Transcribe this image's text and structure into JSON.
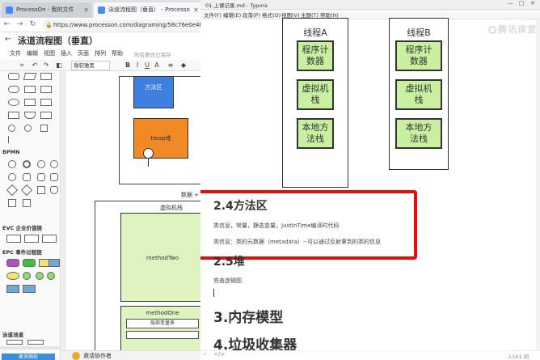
{
  "browser": {
    "tabs": [
      {
        "label": "ProcessOn - 我的文件"
      },
      {
        "label": "泳道流程图（垂直） - Processo"
      }
    ],
    "url": "https://www.processon.com/diagraming/58c76e0e4b",
    "nav": {
      "back": "←",
      "forward": "→",
      "reload": "↻"
    }
  },
  "processon": {
    "back_arrow": "←",
    "title": "泳道流程图（垂直）",
    "menu": [
      "文件",
      "编辑",
      "视图",
      "插入",
      "页面",
      "排列",
      "帮助"
    ],
    "saved_text": "所有更改已保存",
    "toolbar": {
      "undo": "↶",
      "redo": "↷",
      "bold": "B",
      "italic": "I",
      "underline": "U",
      "font_color": "A",
      "align": "≡"
    },
    "font_value": "微软雅黑",
    "categories": [
      "BPMN",
      "EVC 企业价值链",
      "EPC 事件过程链",
      "泳道池道"
    ],
    "more_shapes": "更多图形",
    "canvas": {
      "method_area": "方法区",
      "heap": "Heap堆",
      "mid_label": "数据 + 指令",
      "jvm_stack": "虚拟机栈",
      "method_two": "methodTwo",
      "method_one": "methodOne",
      "local_vars": "局部变量表"
    },
    "status": {
      "invite": "邀请协作者"
    }
  },
  "typora": {
    "window_title": "01.上课记录.md - Typora",
    "window_controls": {
      "minimize": "—",
      "maximize": "□",
      "close": "✕"
    },
    "menu": [
      "文件(F)",
      "编辑(E)",
      "段落(P)",
      "格式(O)",
      "视图(V)",
      "主题(T)",
      "帮助(H)"
    ],
    "watermark": "腾讯课堂",
    "thread_a": {
      "label": "线程A",
      "boxes": [
        "程序计\n数器",
        "虚拟机\n栈",
        "本地方\n法栈"
      ]
    },
    "thread_b": {
      "label": "线程B",
      "boxes": [
        "程序计\n数器",
        "虚拟机\n栈",
        "本地方\n法栈"
      ]
    },
    "section_24": {
      "heading": "2.4方法区",
      "line1": "类信息，常量，静态变量，JustInTime编译时代码",
      "line2": "类信息：类的元数据（metadata）--可以通过反射拿到的类的信息"
    },
    "section_25": {
      "heading": "2.5堆",
      "line1": "完善逻辑图"
    },
    "heading_3": "3.内存模型",
    "heading_4": "4.垃圾收集器",
    "status": {
      "outline": "‹",
      "source": "</>",
      "word_count": "1161 词"
    }
  }
}
